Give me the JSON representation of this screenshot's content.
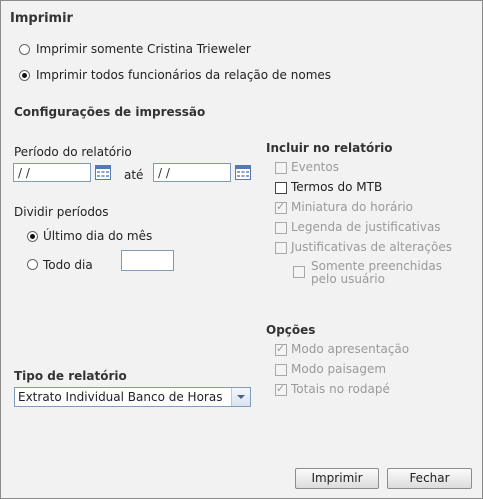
{
  "title": "Imprimir",
  "print_scope": {
    "options": [
      {
        "label": "Imprimir somente Cristina Trieweler",
        "selected": false
      },
      {
        "label": "Imprimir todos funcionários da relação de nomes",
        "selected": true
      }
    ]
  },
  "config": {
    "title": "Configurações de impressão",
    "period": {
      "label": "Período do relatório",
      "from": " /  /",
      "until_label": "até",
      "to": " /  /"
    },
    "divide": {
      "label": "Dividir períodos",
      "options": [
        {
          "label": "Último dia do mês",
          "selected": true
        },
        {
          "label": "Todo dia",
          "selected": false
        }
      ],
      "day_value": ""
    },
    "report_type": {
      "label": "Tipo de relatório",
      "value": "Extrato Individual Banco de Horas"
    }
  },
  "include": {
    "title": "Incluir no relatório",
    "items": [
      {
        "label": "Eventos",
        "checked": false,
        "enabled": false
      },
      {
        "label": "Termos do  MTB",
        "checked": false,
        "enabled": true
      },
      {
        "label": "Miniatura do horário",
        "checked": true,
        "enabled": false
      },
      {
        "label": "Legenda de justificativas",
        "checked": false,
        "enabled": false
      },
      {
        "label": "Justificativas de alterações",
        "checked": false,
        "enabled": false
      }
    ],
    "sub": {
      "line1": "Somente preenchidas",
      "line2": "pelo usuário",
      "checked": false,
      "enabled": false
    }
  },
  "options": {
    "title": "Opções",
    "items": [
      {
        "label": "Modo apresentação",
        "checked": true,
        "enabled": false
      },
      {
        "label": "Modo paisagem",
        "checked": false,
        "enabled": false
      },
      {
        "label": "Totais no rodapé",
        "checked": true,
        "enabled": false
      }
    ]
  },
  "buttons": {
    "print": "Imprimir",
    "close": "Fechar"
  }
}
